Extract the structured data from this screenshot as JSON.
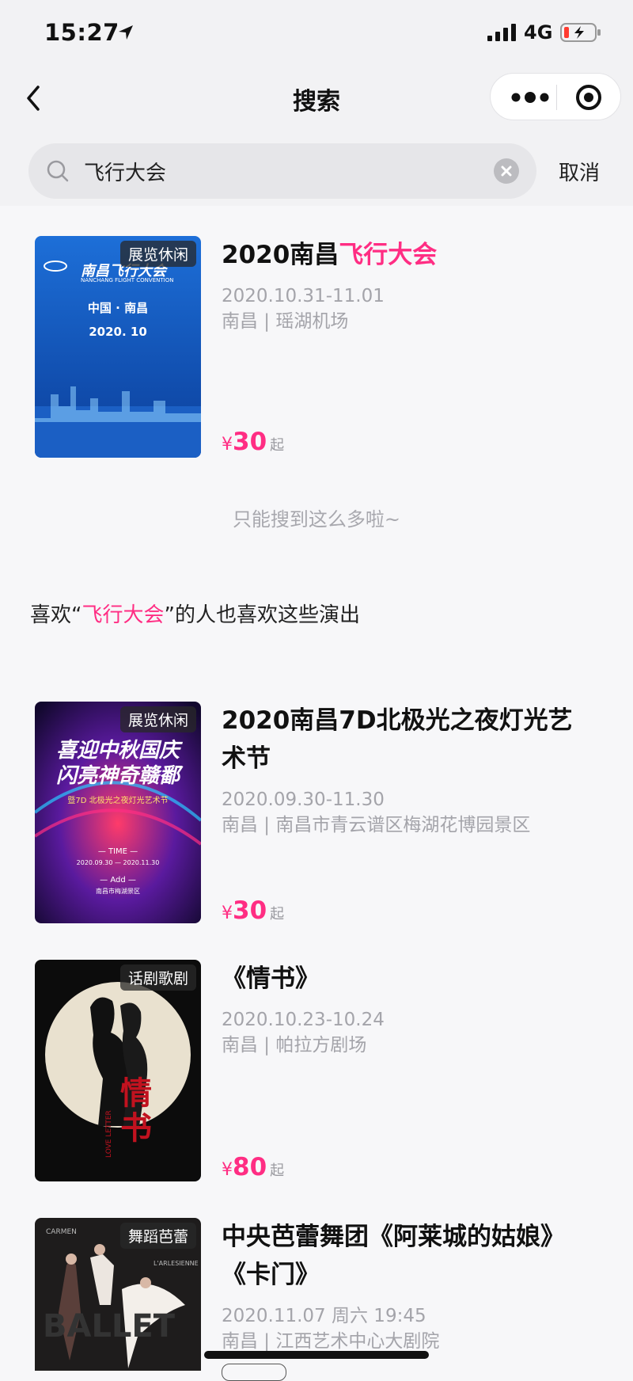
{
  "status": {
    "time": "15:27",
    "network": "4G"
  },
  "nav": {
    "title": "搜索"
  },
  "search": {
    "query": "飞行大会",
    "cancel_label": "取消"
  },
  "results": [
    {
      "tag": "展览休闲",
      "title_prefix": "2020南昌",
      "title_highlight": "飞行大会",
      "date": "2020.10.31-11.01",
      "venue": "南昌 | 瑶湖机场",
      "currency": "¥",
      "price": "30",
      "price_suffix": "起",
      "poster": {
        "text": "南昌飞行大会",
        "subtitle": "NANCHANG FLIGHT CONVENTION",
        "line1": "中国 · 南昌",
        "line2": "2020. 10"
      }
    }
  ],
  "end_hint": "只能搜到这么多啦~",
  "recommend": {
    "prefix": "喜欢“",
    "keyword": "飞行大会",
    "suffix": "”的人也喜欢这些演出"
  },
  "recommendations": [
    {
      "tag": "展览休闲",
      "title": "2020南昌7D北极光之夜灯光艺术节",
      "date": "2020.09.30-11.30",
      "venue": "南昌 | 南昌市青云谱区梅湖花博园景区",
      "currency": "¥",
      "price": "30",
      "price_suffix": "起"
    },
    {
      "tag": "话剧歌剧",
      "title": "《情书》",
      "date": "2020.10.23-10.24",
      "venue": "南昌 | 帕拉方剧场",
      "currency": "¥",
      "price": "80",
      "price_suffix": "起"
    },
    {
      "tag": "舞蹈芭蕾",
      "title": "中央芭蕾舞团《阿莱城的姑娘》《卡门》",
      "date": "2020.11.07 周六 19:45",
      "venue": "南昌 | 江西艺术中心大剧院"
    }
  ],
  "icons": {
    "back": "chevron-left-icon",
    "more": "more-dots-icon",
    "target": "target-icon",
    "search": "search-icon",
    "clear": "clear-icon"
  },
  "colors": {
    "accent": "#ff2d83",
    "background": "#f7f7f9",
    "search_bg": "#e6e6e9"
  }
}
